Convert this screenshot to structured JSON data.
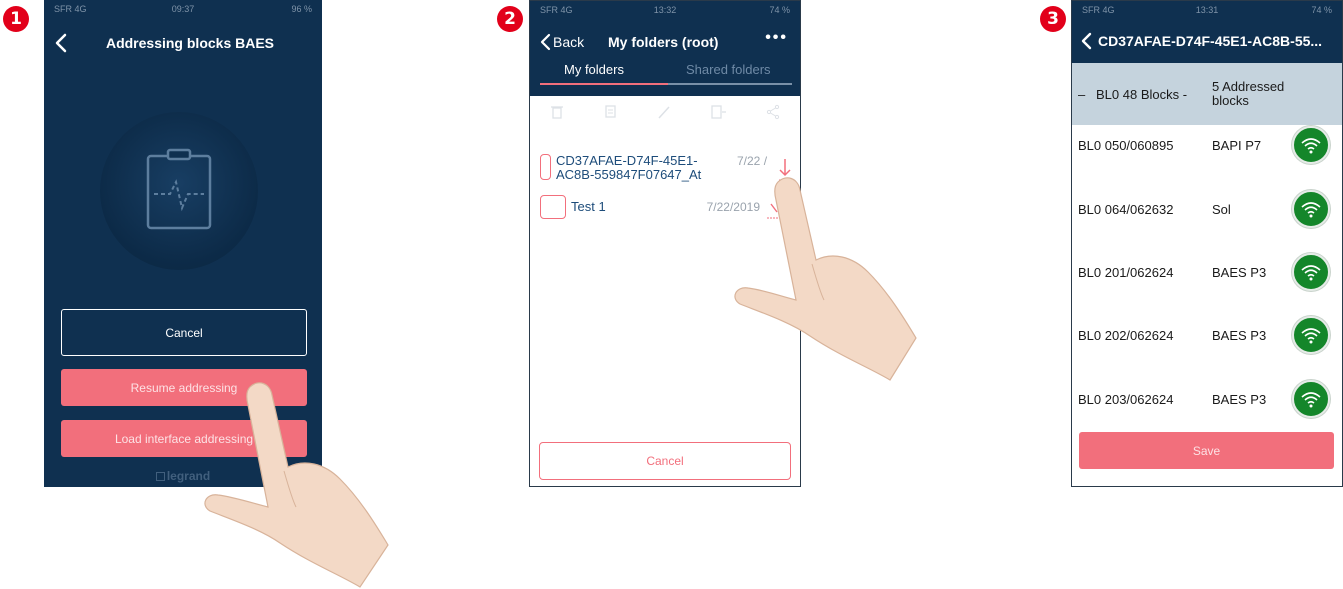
{
  "steps": [
    "1",
    "2",
    "3"
  ],
  "screen1": {
    "status": {
      "carrier": "SFR 4G",
      "time": "09:37",
      "battery": "96 %"
    },
    "title": "Addressing blocks BAES",
    "cancel_label": "Cancel",
    "resume_label": "Resume addressing",
    "load_label": "Load interface addressing",
    "brand": "legrand"
  },
  "screen2": {
    "status": {
      "carrier": "SFR 4G",
      "time": "13:32",
      "battery": "74 %"
    },
    "back_label": "Back",
    "title": "My folders (root)",
    "more_label": "•••",
    "tabs": [
      {
        "label": "My folders"
      },
      {
        "label": "Shared folders"
      }
    ],
    "folders": [
      {
        "name": "CD37AFAE-D74F-45E1-AC8B-559847F07647_At",
        "date": "7/22 /"
      },
      {
        "name": "Test 1",
        "date": "7/22/2019"
      }
    ],
    "cancel_label": "Cancel"
  },
  "screen3": {
    "status": {
      "carrier": "SFR 4G",
      "time": "13:31",
      "battery": "74 %"
    },
    "title": "CD37AFAE-D74F-45E1-AC8B-55...",
    "header": {
      "dash": "–",
      "blocks": "BL0 48 Blocks -",
      "addressed": "5 Addressed blocks"
    },
    "blocks": [
      {
        "code": "BL0 050/060895",
        "location": "BAPI P7"
      },
      {
        "code": "BL0 064/062632",
        "location": "Sol"
      },
      {
        "code": "BL0 201/062624",
        "location": "BAES P3"
      },
      {
        "code": "BL0 202/062624",
        "location": "BAES P3"
      },
      {
        "code": "BL0 203/062624",
        "location": "BAES P3"
      }
    ],
    "save_label": "Save",
    "colors": {
      "accent": "#f26f7c",
      "navy": "#0f3050",
      "wifi": "#14862a"
    }
  }
}
